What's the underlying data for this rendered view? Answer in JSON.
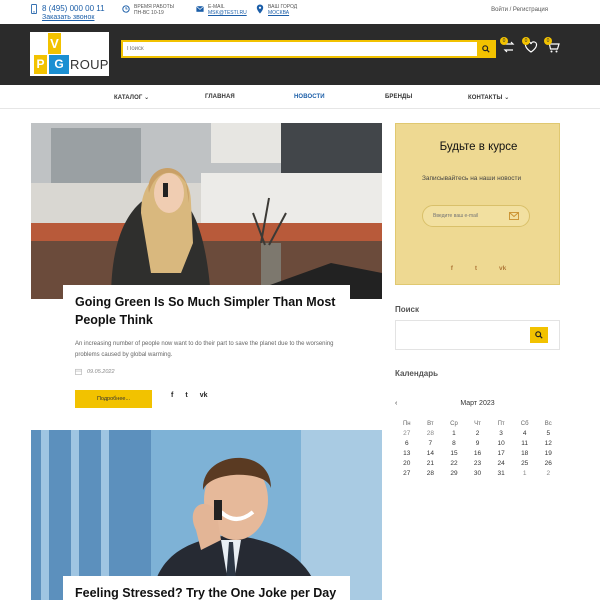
{
  "topbar": {
    "phone": "8 (495) 000 00 11",
    "callback": "Заказать звонок",
    "hours_label": "Время работы",
    "hours_value": "ПН-ВС 10-19",
    "email_label": "E-mail",
    "email_value": "MSK@TESTI.RU",
    "city_label": "Ваш город",
    "city_value": "МОСКВА",
    "auth": "Войти / Регистрация"
  },
  "header": {
    "logo": {
      "v": "V",
      "p": "P",
      "g": "G",
      "roup": "ROUP"
    },
    "search_placeholder": "Поиск",
    "badges": {
      "compare": "0",
      "favorites": "0",
      "cart": "0"
    },
    "colors": {
      "accent": "#f2c200",
      "dark": "#2b2b2b",
      "blue": "#1b8fd2"
    }
  },
  "nav": {
    "items": [
      {
        "label": "КАТАЛОГ",
        "dropdown": true
      },
      {
        "label": "ГЛАВНАЯ",
        "dropdown": false
      },
      {
        "label": "НОВОСТИ",
        "dropdown": false,
        "active": true
      },
      {
        "label": "БРЕНДЫ",
        "dropdown": false
      },
      {
        "label": "КОНТАКТЫ",
        "dropdown": true
      }
    ]
  },
  "posts": [
    {
      "title": "Going Green Is So Much Simpler Than Most People Think",
      "excerpt": "An increasing number of people now want to do their part to save the planet due to the worsening problems caused by global warming.",
      "date": "09.05.2022",
      "more_label": "Подробнее...",
      "share": [
        "f",
        "t",
        "vk"
      ]
    },
    {
      "title": "Feeling Stressed? Try the One Joke per Day"
    }
  ],
  "sidebar": {
    "subscribe": {
      "title": "Будьте в курсе",
      "text": "Записывайтесь на наши новости",
      "placeholder": "Введите ваш e-mail",
      "social": [
        "f",
        "t",
        "vk"
      ]
    },
    "search_heading": "Поиск",
    "calendar_heading": "Календарь",
    "calendar": {
      "month": "Март 2023",
      "prev": "‹",
      "weekdays": [
        "Пн",
        "Вт",
        "Ср",
        "Чт",
        "Пт",
        "Сб",
        "Вс"
      ],
      "weeks": [
        [
          "27",
          "28",
          "1",
          "2",
          "3",
          "4",
          "5"
        ],
        [
          "6",
          "7",
          "8",
          "9",
          "10",
          "11",
          "12"
        ],
        [
          "13",
          "14",
          "15",
          "16",
          "17",
          "18",
          "19"
        ],
        [
          "20",
          "21",
          "22",
          "23",
          "24",
          "25",
          "26"
        ],
        [
          "27",
          "28",
          "29",
          "30",
          "31",
          "1",
          "2"
        ]
      ]
    }
  }
}
